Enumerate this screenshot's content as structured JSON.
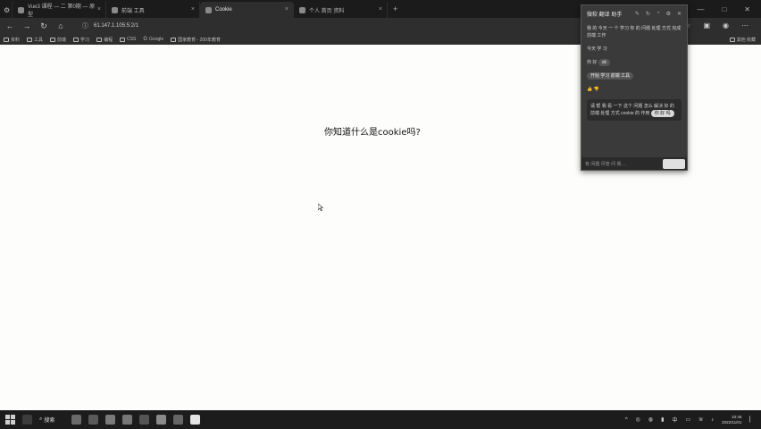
{
  "tabs": [
    {
      "label": "Vue3 课程 — 二 第0期 — 原型",
      "active": false
    },
    {
      "label": "前端 工具",
      "active": false
    },
    {
      "label": "Cookie",
      "active": true
    },
    {
      "label": "个人 首页 资料",
      "active": false
    }
  ],
  "toolbar": {
    "url": "61.147.1.105:5:2/1"
  },
  "bookmarks": {
    "items": [
      "资料",
      "工具",
      "前端",
      "学习",
      "编程",
      "CSS",
      "Google",
      "国家教育 - 200年教育"
    ],
    "right": "其他 收藏"
  },
  "page": {
    "question": "你知道什么是cookie吗?"
  },
  "panel": {
    "title": "微软 翻译 助手",
    "messages": [
      "我 的 今天 一 个 学习 你 的 问题 处理 方式 完成 前端 工作",
      "今天 学 习",
      "你 好"
    ],
    "pill_1": "开始 学习 前端 工具",
    "pill_2": "ok",
    "reply": "请 帮 我 看 一下 这个 问题 怎么 解决 好 的 前端 处理 方式 cookie 的 作用",
    "reply_pill": "你 好 吗",
    "input_placeholder": "有 问题 尽管 问 我 ..."
  },
  "taskbar": {
    "search": "搜索",
    "time": "10:45",
    "date": "2022/11/01"
  }
}
